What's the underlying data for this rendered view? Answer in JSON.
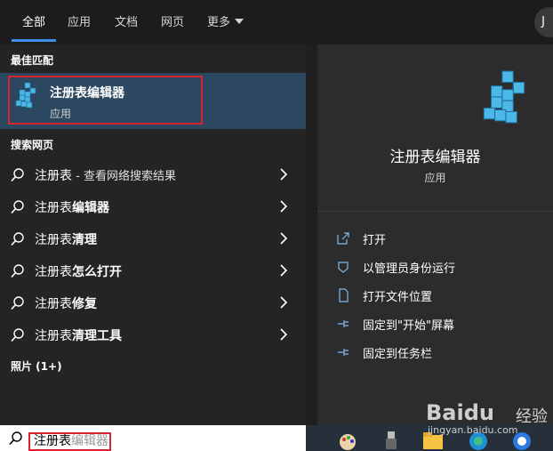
{
  "tabs": [
    {
      "label": "全部"
    },
    {
      "label": "应用"
    },
    {
      "label": "文档"
    },
    {
      "label": "网页"
    },
    {
      "label": "更多"
    }
  ],
  "user_initial": "J",
  "best_match": {
    "header": "最佳匹配",
    "title": "注册表编辑器",
    "subtitle": "应用"
  },
  "web_search": {
    "header": "搜索网页",
    "items": [
      {
        "prefix": "注册表",
        "bold": "",
        "hint": " - 查看网络搜索结果"
      },
      {
        "prefix": "注册表",
        "bold": "编辑器",
        "hint": ""
      },
      {
        "prefix": "注册表",
        "bold": "清理",
        "hint": ""
      },
      {
        "prefix": "注册表",
        "bold": "怎么打开",
        "hint": ""
      },
      {
        "prefix": "注册表",
        "bold": "修复",
        "hint": ""
      },
      {
        "prefix": "注册表",
        "bold": "清理工具",
        "hint": ""
      }
    ]
  },
  "photos_header": "照片 (1+)",
  "detail": {
    "title": "注册表编辑器",
    "subtitle": "应用",
    "actions": [
      {
        "label": "打开",
        "icon": "open-icon"
      },
      {
        "label": "以管理员身份运行",
        "icon": "shield-icon"
      },
      {
        "label": "打开文件位置",
        "icon": "file-location-icon"
      },
      {
        "label": "固定到\"开始\"屏幕",
        "icon": "pin-icon"
      },
      {
        "label": "固定到任务栏",
        "icon": "pin-icon"
      }
    ]
  },
  "search": {
    "typed": "注册表",
    "suggestion": "编辑器"
  },
  "watermark": {
    "brand": "Baidu",
    "cn": "经验",
    "url": "jingyan.baidu.com"
  },
  "colors": {
    "accent": "#3b8eea",
    "selected_bg": "#2b4860",
    "highlight_box": "#d8242f"
  }
}
